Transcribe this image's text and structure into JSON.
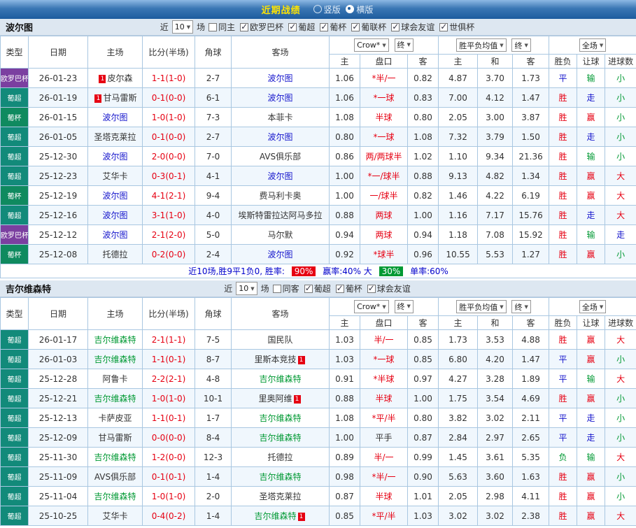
{
  "titlebar": {
    "title": "近期战绩",
    "layout_options": [
      {
        "label": "竖版",
        "selected": false
      },
      {
        "label": "横版",
        "selected": true
      }
    ]
  },
  "colors": {
    "result_win_red": "#e60012",
    "result_draw_blue": "#1414cc",
    "result_loss_green": "#009933",
    "home_team_blue": "#1414cc",
    "away_team_green": "#009933",
    "type_europa_purple": "#7b3fa0",
    "type_liga_teal": "#128a7a",
    "type_cup_green": "#0f8a5f",
    "win_rate_badge_bg": "#e60012",
    "big_rate_badge_bg": "#009933"
  },
  "filter_labels": {
    "near": "近",
    "count": "10",
    "games": "场"
  },
  "table_headers": {
    "type": "类型",
    "date": "日期",
    "home": "主场",
    "score": "比分(半场)",
    "corners": "角球",
    "away": "客场",
    "odds_source": "Crow*",
    "final_a": "终",
    "wdl_avg": "胜平负均值",
    "final_b": "终",
    "scope": "全场",
    "ah_home": "主",
    "ah_line": "盘口",
    "ah_away": "客",
    "avg_home": "主",
    "avg_draw": "和",
    "avg_away": "客",
    "res_wdl": "胜负",
    "res_handicap": "让球",
    "res_goals": "进球数"
  },
  "sections": [
    {
      "team": "波尔图",
      "venue_filter": {
        "label": "同主",
        "checked": false
      },
      "league_filters": [
        {
          "label": "欧罗巴杯",
          "checked": true
        },
        {
          "label": "葡超",
          "checked": true
        },
        {
          "label": "葡杯",
          "checked": true
        },
        {
          "label": "葡联杯",
          "checked": true
        },
        {
          "label": "球会友谊",
          "checked": true
        },
        {
          "label": "世俱杯",
          "checked": true
        }
      ],
      "rows": [
        {
          "type": "欧罗巴杯",
          "date": "26-01-23",
          "home_name": "皮尔森",
          "home_color": "dark",
          "home_badge": "1",
          "score": "1-1(1-0)",
          "corners": "2-7",
          "away_name": "波尔图",
          "away_color": "blue",
          "away_badge": "",
          "ah_home": "1.06",
          "ah_line": "*半/一",
          "ah_line_color": "red",
          "ah_away": "0.82",
          "avg_home": "4.87",
          "avg_draw": "3.70",
          "avg_away": "1.73",
          "res_wdl": "平",
          "res_wdl_color": "blue",
          "res_handicap": "输",
          "res_handicap_color": "green",
          "res_goals": "小",
          "res_goals_color": "green"
        },
        {
          "type": "葡超",
          "date": "26-01-19",
          "home_name": "甘马雷斯",
          "home_color": "dark",
          "home_badge": "1",
          "score": "0-1(0-0)",
          "corners": "6-1",
          "away_name": "波尔图",
          "away_color": "blue",
          "away_badge": "",
          "ah_home": "1.06",
          "ah_line": "*一球",
          "ah_line_color": "red",
          "ah_away": "0.83",
          "avg_home": "7.00",
          "avg_draw": "4.12",
          "avg_away": "1.47",
          "res_wdl": "胜",
          "res_wdl_color": "red",
          "res_handicap": "走",
          "res_handicap_color": "blue",
          "res_goals": "小",
          "res_goals_color": "green"
        },
        {
          "type": "葡杯",
          "date": "26-01-15",
          "home_name": "波尔图",
          "home_color": "blue",
          "home_badge": "",
          "score": "1-0(1-0)",
          "corners": "7-3",
          "away_name": "本菲卡",
          "away_color": "dark",
          "away_badge": "",
          "ah_home": "1.08",
          "ah_line": "半球",
          "ah_line_color": "red",
          "ah_away": "0.80",
          "avg_home": "2.05",
          "avg_draw": "3.00",
          "avg_away": "3.87",
          "res_wdl": "胜",
          "res_wdl_color": "red",
          "res_handicap": "赢",
          "res_handicap_color": "red",
          "res_goals": "小",
          "res_goals_color": "green"
        },
        {
          "type": "葡超",
          "date": "26-01-05",
          "home_name": "圣塔克莱拉",
          "home_color": "dark",
          "home_badge": "",
          "score": "0-1(0-0)",
          "corners": "2-7",
          "away_name": "波尔图",
          "away_color": "blue",
          "away_badge": "",
          "ah_home": "0.80",
          "ah_line": "*一球",
          "ah_line_color": "red",
          "ah_away": "1.08",
          "avg_home": "7.32",
          "avg_draw": "3.79",
          "avg_away": "1.50",
          "res_wdl": "胜",
          "res_wdl_color": "red",
          "res_handicap": "走",
          "res_handicap_color": "blue",
          "res_goals": "小",
          "res_goals_color": "green"
        },
        {
          "type": "葡超",
          "date": "25-12-30",
          "home_name": "波尔图",
          "home_color": "blue",
          "home_badge": "",
          "score": "2-0(0-0)",
          "corners": "7-0",
          "away_name": "AVS俱乐部",
          "away_color": "dark",
          "away_badge": "",
          "ah_home": "0.86",
          "ah_line": "两/两球半",
          "ah_line_color": "red",
          "ah_away": "1.02",
          "avg_home": "1.10",
          "avg_draw": "9.34",
          "avg_away": "21.36",
          "res_wdl": "胜",
          "res_wdl_color": "red",
          "res_handicap": "输",
          "res_handicap_color": "green",
          "res_goals": "小",
          "res_goals_color": "green"
        },
        {
          "type": "葡超",
          "date": "25-12-23",
          "home_name": "艾华卡",
          "home_color": "dark",
          "home_badge": "",
          "score": "0-3(0-1)",
          "corners": "4-1",
          "away_name": "波尔图",
          "away_color": "blue",
          "away_badge": "",
          "ah_home": "1.00",
          "ah_line": "*一/球半",
          "ah_line_color": "red",
          "ah_away": "0.88",
          "avg_home": "9.13",
          "avg_draw": "4.82",
          "avg_away": "1.34",
          "res_wdl": "胜",
          "res_wdl_color": "red",
          "res_handicap": "赢",
          "res_handicap_color": "red",
          "res_goals": "大",
          "res_goals_color": "red"
        },
        {
          "type": "葡杯",
          "date": "25-12-19",
          "home_name": "波尔图",
          "home_color": "blue",
          "home_badge": "",
          "score": "4-1(2-1)",
          "corners": "9-4",
          "away_name": "费马利卡奥",
          "away_color": "dark",
          "away_badge": "",
          "ah_home": "1.00",
          "ah_line": "一/球半",
          "ah_line_color": "red",
          "ah_away": "0.82",
          "avg_home": "1.46",
          "avg_draw": "4.22",
          "avg_away": "6.19",
          "res_wdl": "胜",
          "res_wdl_color": "red",
          "res_handicap": "赢",
          "res_handicap_color": "red",
          "res_goals": "大",
          "res_goals_color": "red"
        },
        {
          "type": "葡超",
          "date": "25-12-16",
          "home_name": "波尔图",
          "home_color": "blue",
          "home_badge": "",
          "score": "3-1(1-0)",
          "corners": "4-0",
          "away_name": "埃斯特雷拉达阿马多拉",
          "away_color": "dark",
          "away_badge": "",
          "ah_home": "0.88",
          "ah_line": "两球",
          "ah_line_color": "red",
          "ah_away": "1.00",
          "avg_home": "1.16",
          "avg_draw": "7.17",
          "avg_away": "15.76",
          "res_wdl": "胜",
          "res_wdl_color": "red",
          "res_handicap": "走",
          "res_handicap_color": "blue",
          "res_goals": "大",
          "res_goals_color": "red"
        },
        {
          "type": "欧罗巴杯",
          "date": "25-12-12",
          "home_name": "波尔图",
          "home_color": "blue",
          "home_badge": "",
          "score": "2-1(2-0)",
          "corners": "5-0",
          "away_name": "马尔默",
          "away_color": "dark",
          "away_badge": "",
          "ah_home": "0.94",
          "ah_line": "两球",
          "ah_line_color": "red",
          "ah_away": "0.94",
          "avg_home": "1.18",
          "avg_draw": "7.08",
          "avg_away": "15.92",
          "res_wdl": "胜",
          "res_wdl_color": "red",
          "res_handicap": "输",
          "res_handicap_color": "green",
          "res_goals": "走",
          "res_goals_color": "blue"
        },
        {
          "type": "葡杯",
          "date": "25-12-08",
          "home_name": "托德拉",
          "home_color": "dark",
          "home_badge": "",
          "score": "0-2(0-0)",
          "corners": "2-4",
          "away_name": "波尔图",
          "away_color": "blue",
          "away_badge": "",
          "ah_home": "0.92",
          "ah_line": "*球半",
          "ah_line_color": "red",
          "ah_away": "0.96",
          "avg_home": "10.55",
          "avg_draw": "5.53",
          "avg_away": "1.27",
          "res_wdl": "胜",
          "res_wdl_color": "red",
          "res_handicap": "赢",
          "res_handicap_color": "red",
          "res_goals": "小",
          "res_goals_color": "green"
        }
      ],
      "summary": {
        "prefix": "近10场,胜9平1负0, 胜率:",
        "win_rate": "90%",
        "mid": "赢率:40% 大",
        "big_rate": "30%",
        "suffix": "单率:60%"
      }
    },
    {
      "team": "吉尔维森特",
      "venue_filter": {
        "label": "同客",
        "checked": false
      },
      "league_filters": [
        {
          "label": "葡超",
          "checked": true
        },
        {
          "label": "葡杯",
          "checked": true
        },
        {
          "label": "球会友谊",
          "checked": true
        }
      ],
      "rows": [
        {
          "type": "葡超",
          "date": "26-01-17",
          "home_name": "吉尔维森特",
          "home_color": "green",
          "home_badge": "",
          "score": "2-1(1-1)",
          "corners": "7-5",
          "away_name": "国民队",
          "away_color": "dark",
          "away_badge": "",
          "ah_home": "1.03",
          "ah_line": "半/一",
          "ah_line_color": "red",
          "ah_away": "0.85",
          "avg_home": "1.73",
          "avg_draw": "3.53",
          "avg_away": "4.88",
          "res_wdl": "胜",
          "res_wdl_color": "red",
          "res_handicap": "赢",
          "res_handicap_color": "red",
          "res_goals": "大",
          "res_goals_color": "red"
        },
        {
          "type": "葡超",
          "date": "26-01-03",
          "home_name": "吉尔维森特",
          "home_color": "green",
          "home_badge": "",
          "score": "1-1(0-1)",
          "corners": "8-7",
          "away_name": "里斯本竞技",
          "away_color": "dark",
          "away_badge": "1",
          "ah_home": "1.03",
          "ah_line": "*一球",
          "ah_line_color": "red",
          "ah_away": "0.85",
          "avg_home": "6.80",
          "avg_draw": "4.20",
          "avg_away": "1.47",
          "res_wdl": "平",
          "res_wdl_color": "blue",
          "res_handicap": "赢",
          "res_handicap_color": "red",
          "res_goals": "小",
          "res_goals_color": "green"
        },
        {
          "type": "葡超",
          "date": "25-12-28",
          "home_name": "阿鲁卡",
          "home_color": "dark",
          "home_badge": "",
          "score": "2-2(2-1)",
          "corners": "4-8",
          "away_name": "吉尔维森特",
          "away_color": "green",
          "away_badge": "",
          "ah_home": "0.91",
          "ah_line": "*半球",
          "ah_line_color": "red",
          "ah_away": "0.97",
          "avg_home": "4.27",
          "avg_draw": "3.28",
          "avg_away": "1.89",
          "res_wdl": "平",
          "res_wdl_color": "blue",
          "res_handicap": "输",
          "res_handicap_color": "green",
          "res_goals": "大",
          "res_goals_color": "red"
        },
        {
          "type": "葡超",
          "date": "25-12-21",
          "home_name": "吉尔维森特",
          "home_color": "green",
          "home_badge": "",
          "score": "1-0(1-0)",
          "corners": "10-1",
          "away_name": "里奥阿维",
          "away_color": "dark",
          "away_badge": "1",
          "ah_home": "0.88",
          "ah_line": "半球",
          "ah_line_color": "red",
          "ah_away": "1.00",
          "avg_home": "1.75",
          "avg_draw": "3.54",
          "avg_away": "4.69",
          "res_wdl": "胜",
          "res_wdl_color": "red",
          "res_handicap": "赢",
          "res_handicap_color": "red",
          "res_goals": "小",
          "res_goals_color": "green"
        },
        {
          "type": "葡超",
          "date": "25-12-13",
          "home_name": "卡萨皮亚",
          "home_color": "dark",
          "home_badge": "",
          "score": "1-1(0-1)",
          "corners": "1-7",
          "away_name": "吉尔维森特",
          "away_color": "green",
          "away_badge": "",
          "ah_home": "1.08",
          "ah_line": "*平/半",
          "ah_line_color": "red",
          "ah_away": "0.80",
          "avg_home": "3.82",
          "avg_draw": "3.02",
          "avg_away": "2.11",
          "res_wdl": "平",
          "res_wdl_color": "blue",
          "res_handicap": "走",
          "res_handicap_color": "blue",
          "res_goals": "小",
          "res_goals_color": "green"
        },
        {
          "type": "葡超",
          "date": "25-12-09",
          "home_name": "甘马雷斯",
          "home_color": "dark",
          "home_badge": "",
          "score": "0-0(0-0)",
          "corners": "8-4",
          "away_name": "吉尔维森特",
          "away_color": "green",
          "away_badge": "",
          "ah_home": "1.00",
          "ah_line": "平手",
          "ah_line_color": "dark",
          "ah_away": "0.87",
          "avg_home": "2.84",
          "avg_draw": "2.97",
          "avg_away": "2.65",
          "res_wdl": "平",
          "res_wdl_color": "blue",
          "res_handicap": "走",
          "res_handicap_color": "blue",
          "res_goals": "小",
          "res_goals_color": "green"
        },
        {
          "type": "葡超",
          "date": "25-11-30",
          "home_name": "吉尔维森特",
          "home_color": "green",
          "home_badge": "",
          "score": "1-2(0-0)",
          "corners": "12-3",
          "away_name": "托德拉",
          "away_color": "dark",
          "away_badge": "",
          "ah_home": "0.89",
          "ah_line": "半/一",
          "ah_line_color": "red",
          "ah_away": "0.99",
          "avg_home": "1.45",
          "avg_draw": "3.61",
          "avg_away": "5.35",
          "res_wdl": "负",
          "res_wdl_color": "green",
          "res_handicap": "输",
          "res_handicap_color": "green",
          "res_goals": "大",
          "res_goals_color": "red"
        },
        {
          "type": "葡超",
          "date": "25-11-09",
          "home_name": "AVS俱乐部",
          "home_color": "dark",
          "home_badge": "",
          "score": "0-1(0-1)",
          "corners": "1-4",
          "away_name": "吉尔维森特",
          "away_color": "green",
          "away_badge": "",
          "ah_home": "0.98",
          "ah_line": "*半/一",
          "ah_line_color": "red",
          "ah_away": "0.90",
          "avg_home": "5.63",
          "avg_draw": "3.60",
          "avg_away": "1.63",
          "res_wdl": "胜",
          "res_wdl_color": "red",
          "res_handicap": "赢",
          "res_handicap_color": "red",
          "res_goals": "小",
          "res_goals_color": "green"
        },
        {
          "type": "葡超",
          "date": "25-11-04",
          "home_name": "吉尔维森特",
          "home_color": "green",
          "home_badge": "",
          "score": "1-0(1-0)",
          "corners": "2-0",
          "away_name": "圣塔克莱拉",
          "away_color": "dark",
          "away_badge": "",
          "ah_home": "0.87",
          "ah_line": "半球",
          "ah_line_color": "red",
          "ah_away": "1.01",
          "avg_home": "2.05",
          "avg_draw": "2.98",
          "avg_away": "4.11",
          "res_wdl": "胜",
          "res_wdl_color": "red",
          "res_handicap": "赢",
          "res_handicap_color": "red",
          "res_goals": "小",
          "res_goals_color": "green"
        },
        {
          "type": "葡超",
          "date": "25-10-25",
          "home_name": "艾华卡",
          "home_color": "dark",
          "home_badge": "",
          "score": "0-4(0-2)",
          "corners": "1-4",
          "away_name": "吉尔维森特",
          "away_color": "green",
          "away_badge": "1",
          "ah_home": "0.85",
          "ah_line": "*平/半",
          "ah_line_color": "red",
          "ah_away": "1.03",
          "avg_home": "3.02",
          "avg_draw": "3.02",
          "avg_away": "2.38",
          "res_wdl": "胜",
          "res_wdl_color": "red",
          "res_handicap": "赢",
          "res_handicap_color": "red",
          "res_goals": "大",
          "res_goals_color": "red"
        }
      ],
      "summary": null
    }
  ]
}
